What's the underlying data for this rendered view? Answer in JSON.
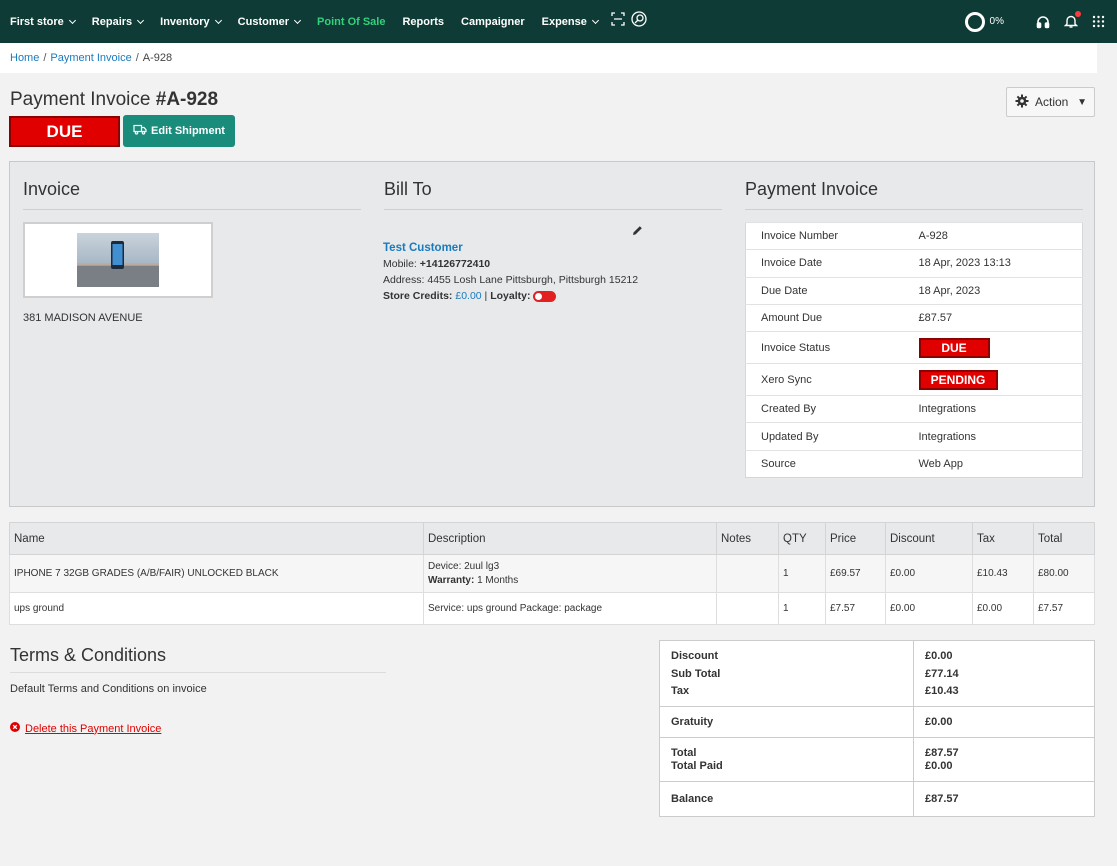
{
  "nav": {
    "items": [
      {
        "label": "First store",
        "chevron": true
      },
      {
        "label": "Repairs",
        "chevron": true
      },
      {
        "label": "Inventory",
        "chevron": true
      },
      {
        "label": "Customer",
        "chevron": true
      },
      {
        "label": "Point Of Sale",
        "chevron": false,
        "active": true
      },
      {
        "label": "Reports",
        "chevron": false
      },
      {
        "label": "Campaigner",
        "chevron": false
      },
      {
        "label": "Expense",
        "chevron": true
      }
    ],
    "progress": "0%",
    "accent_color": "#33d17a",
    "bar_color": "#0e3b35"
  },
  "breadcrumb": {
    "home": "Home",
    "section": "Payment Invoice",
    "current": "A-928"
  },
  "header": {
    "title_prefix": "Payment Invoice ",
    "title_number": "#A-928",
    "status": "DUE",
    "edit_shipment": "Edit Shipment",
    "action": "Action"
  },
  "invoice_col": {
    "title": "Invoice",
    "store_address": "381 MADISON AVENUE"
  },
  "bill_to": {
    "title": "Bill To",
    "customer": "Test Customer",
    "mobile_label": "Mobile: ",
    "mobile": "+14126772410",
    "address_label": "Address: ",
    "address": "4455 Losh Lane Pittsburgh, Pittsburgh 15212",
    "store_credits_label": "Store Credits: ",
    "store_credits": "£0.00",
    "separator": " | ",
    "loyalty_label": "Loyalty: "
  },
  "payment_invoice": {
    "title": "Payment Invoice",
    "rows": [
      {
        "label": "Invoice Number",
        "value": "A-928"
      },
      {
        "label": "Invoice Date",
        "value": "18 Apr, 2023 13:13"
      },
      {
        "label": "Due Date",
        "value": "18 Apr, 2023"
      },
      {
        "label": "Amount Due",
        "value": "£87.57"
      },
      {
        "label": "Invoice Status",
        "value": "DUE"
      },
      {
        "label": "Xero Sync",
        "value": "PENDING"
      },
      {
        "label": "Created By",
        "value": "Integrations"
      },
      {
        "label": "Updated By",
        "value": "Integrations"
      },
      {
        "label": "Source",
        "value": "Web App"
      }
    ]
  },
  "items": {
    "headers": [
      "Name",
      "Description",
      "Notes",
      "QTY",
      "Price",
      "Discount",
      "Tax",
      "Total"
    ],
    "rows": [
      {
        "name": "IPHONE 7 32GB GRADES (A/B/FAIR) UNLOCKED BLACK",
        "desc_line1": "Device: 2uul lg3",
        "desc_line2_label": "Warranty:",
        "desc_line2": " 1 Months",
        "notes": "",
        "qty": "1",
        "price": "£69.57",
        "discount": "£0.00",
        "tax": "£10.43",
        "total": "£80.00"
      },
      {
        "name": "ups ground",
        "desc_line1": "Service: ups ground Package: package",
        "notes": "",
        "qty": "1",
        "price": "£7.57",
        "discount": "£0.00",
        "tax": "£0.00",
        "total": "£7.57"
      }
    ]
  },
  "terms": {
    "title": "Terms & Conditions",
    "text": "Default Terms and Conditions on invoice",
    "delete_link": "Delete this Payment Invoice"
  },
  "totals": {
    "discount_label": "Discount",
    "discount": "£0.00",
    "subtotal_label": "Sub Total",
    "subtotal": "£77.14",
    "tax_label": "Tax",
    "tax": "£10.43",
    "gratuity_label": "Gratuity",
    "gratuity": "£0.00",
    "total_label": "Total",
    "total": "£87.57",
    "total_paid_label": "Total Paid",
    "total_paid": "£0.00",
    "balance_label": "Balance",
    "balance": "£87.57"
  }
}
